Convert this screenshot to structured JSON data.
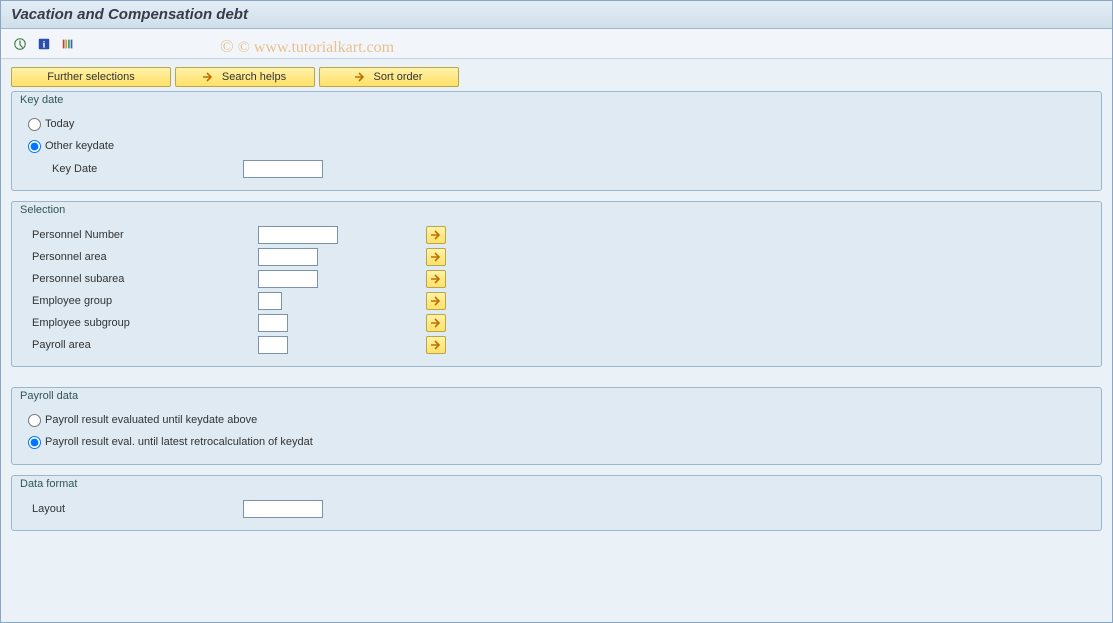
{
  "title": "Vacation and Compensation debt",
  "watermark": "© www.tutorialkart.com",
  "buttons": {
    "further_selections": "Further selections",
    "search_helps": "Search helps",
    "sort_order": "Sort order"
  },
  "groups": {
    "key_date": {
      "title": "Key date",
      "today": "Today",
      "other": "Other keydate",
      "key_date_label": "Key Date"
    },
    "selection": {
      "title": "Selection",
      "rows": [
        {
          "label": "Personnel Number",
          "input_w": "w80"
        },
        {
          "label": "Personnel area",
          "input_w": "w60"
        },
        {
          "label": "Personnel subarea",
          "input_w": "w60"
        },
        {
          "label": "Employee group",
          "input_w": "w24"
        },
        {
          "label": "Employee subgroup",
          "input_w": "w30"
        },
        {
          "label": "Payroll area",
          "input_w": "w30"
        }
      ]
    },
    "payroll_data": {
      "title": "Payroll data",
      "opt1": "Payroll result evaluated until keydate above",
      "opt2": "Payroll result eval. until latest retrocalculation of keydat"
    },
    "data_format": {
      "title": "Data format",
      "layout": "Layout"
    }
  }
}
